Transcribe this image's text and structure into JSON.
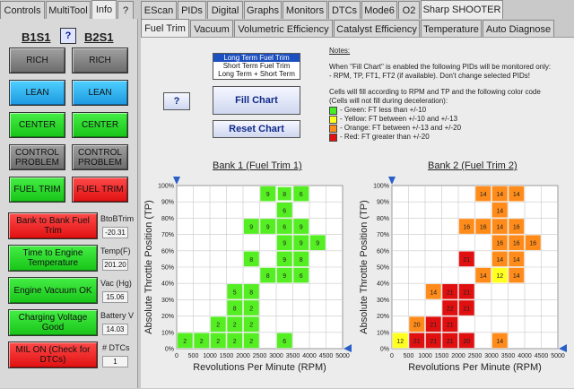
{
  "left_tabs": [
    "Controls",
    "MultiTool",
    "Info",
    "?"
  ],
  "top_tabs": [
    "EScan",
    "PIDs",
    "Digital",
    "Graphs",
    "Monitors",
    "DTCs",
    "Mode6",
    "O2",
    "Sharp SHOOTER"
  ],
  "sub_tabs": [
    "Fuel Trim",
    "Vacuum",
    "Volumetric Efficiency",
    "Catalyst Efficiency",
    "Temperature",
    "Auto Diagnose"
  ],
  "left": {
    "b1": "B1S1",
    "b2": "B2S1",
    "help": "?",
    "rows": [
      {
        "l": "RICH",
        "r": "RICH",
        "lc": "gray",
        "rc": "gray"
      },
      {
        "l": "LEAN",
        "r": "LEAN",
        "lc": "blue",
        "rc": "blue"
      },
      {
        "l": "CENTER",
        "r": "CENTER",
        "lc": "green",
        "rc": "green"
      },
      {
        "l": "CONTROL PROBLEM",
        "r": "CONTROL PROBLEM",
        "lc": "gray",
        "rc": "gray"
      },
      {
        "l": "FUEL TRIM",
        "r": "FUEL TRIM",
        "lc": "green",
        "rc": "red"
      }
    ],
    "status": [
      {
        "label": "Bank to Bank Fuel Trim",
        "color": "red",
        "vlabel": "BtoBTrim",
        "value": "-20.31"
      },
      {
        "label": "Time to Engine Temperature",
        "color": "green",
        "vlabel": "Temp(F)",
        "value": "201.20"
      },
      {
        "label": "Engine Vacuum OK",
        "color": "green",
        "vlabel": "Vac (Hg)",
        "value": "15.06"
      },
      {
        "label": "Charging Voltage Good",
        "color": "green",
        "vlabel": "Battery V",
        "value": "14.03"
      },
      {
        "label": "MIL ON (Check for DTCs)",
        "color": "red",
        "vlabel": "# DTCs",
        "value": "1"
      }
    ]
  },
  "controls": {
    "trim_options": [
      "Long Term Fuel Trim",
      "Short Term Fuel Trim",
      "Long Term + Short Term"
    ],
    "selected": 0,
    "help": "?",
    "fill": "Fill Chart",
    "reset": "Reset Chart"
  },
  "notes": {
    "title": "Notes:",
    "l1": "When \"Fill Chart\" is enabled the following PIDs will be monitored only:",
    "l2": "- RPM, TP, FT1, FT2 (if available). Don't change selected PIDs!",
    "l3": "Cells will fill according to RPM and TP and the following color code",
    "l4": "(Cells will not fill during deceleration):",
    "legend": [
      {
        "c": "#44ee22",
        "t": "- Green:   FT less than +/-10"
      },
      {
        "c": "#ffff20",
        "t": "- Yellow:  FT between +/-10 and +/-13"
      },
      {
        "c": "#ff8c1a",
        "t": "- Orange: FT between +/-13 and +/-20"
      },
      {
        "c": "#e21010",
        "t": "- Red:       FT greater than +/-20"
      }
    ]
  },
  "colors": {
    "green": "#55ee22",
    "yellow": "#ffff20",
    "orange": "#ff8c1a",
    "red": "#e01010",
    "marker": "#2a5fc8"
  },
  "chart_data": [
    {
      "type": "heatmap",
      "title": "Bank 1 (Fuel Trim 1)",
      "xlabel": "Revolutions Per Minute (RPM)",
      "ylabel": "Absolute Throttle Position (TP)",
      "xticks": [
        "0",
        "500",
        "1000",
        "1500",
        "2000",
        "2500",
        "3000",
        "3500",
        "4000",
        "4500",
        "5000"
      ],
      "yticks": [
        "0%",
        "10%",
        "20%",
        "30%",
        "40%",
        "50%",
        "60%",
        "70%",
        "80%",
        "90%",
        "100%"
      ],
      "cells": [
        {
          "c": 0,
          "r": 0,
          "v": "2",
          "col": "green"
        },
        {
          "c": 1,
          "r": 0,
          "v": "2",
          "col": "green"
        },
        {
          "c": 2,
          "r": 0,
          "v": "2",
          "col": "green"
        },
        {
          "c": 3,
          "r": 0,
          "v": "2",
          "col": "green"
        },
        {
          "c": 4,
          "r": 0,
          "v": "2",
          "col": "green"
        },
        {
          "c": 6,
          "r": 0,
          "v": "6",
          "col": "green"
        },
        {
          "c": 2,
          "r": 1,
          "v": "2",
          "col": "green"
        },
        {
          "c": 3,
          "r": 1,
          "v": "2",
          "col": "green"
        },
        {
          "c": 4,
          "r": 1,
          "v": "2",
          "col": "green"
        },
        {
          "c": 3,
          "r": 2,
          "v": "8",
          "col": "green"
        },
        {
          "c": 4,
          "r": 2,
          "v": "2",
          "col": "green"
        },
        {
          "c": 3,
          "r": 3,
          "v": "5",
          "col": "green"
        },
        {
          "c": 4,
          "r": 3,
          "v": "8",
          "col": "green"
        },
        {
          "c": 5,
          "r": 4,
          "v": "8",
          "col": "green"
        },
        {
          "c": 6,
          "r": 4,
          "v": "9",
          "col": "green"
        },
        {
          "c": 7,
          "r": 4,
          "v": "6",
          "col": "green"
        },
        {
          "c": 4,
          "r": 5,
          "v": "8",
          "col": "green"
        },
        {
          "c": 6,
          "r": 5,
          "v": "9",
          "col": "green"
        },
        {
          "c": 7,
          "r": 5,
          "v": "8",
          "col": "green"
        },
        {
          "c": 6,
          "r": 6,
          "v": "9",
          "col": "green"
        },
        {
          "c": 7,
          "r": 6,
          "v": "9",
          "col": "green"
        },
        {
          "c": 8,
          "r": 6,
          "v": "9",
          "col": "green"
        },
        {
          "c": 4,
          "r": 7,
          "v": "9",
          "col": "green"
        },
        {
          "c": 5,
          "r": 7,
          "v": "9",
          "col": "green"
        },
        {
          "c": 6,
          "r": 7,
          "v": "6",
          "col": "green"
        },
        {
          "c": 7,
          "r": 7,
          "v": "9",
          "col": "green"
        },
        {
          "c": 6,
          "r": 8,
          "v": "6",
          "col": "green"
        },
        {
          "c": 5,
          "r": 9,
          "v": "9",
          "col": "green"
        },
        {
          "c": 6,
          "r": 9,
          "v": "8",
          "col": "green"
        },
        {
          "c": 7,
          "r": 9,
          "v": "6",
          "col": "green"
        }
      ],
      "selected": {
        "c": 6,
        "r": 9
      }
    },
    {
      "type": "heatmap",
      "title": "Bank 2 (Fuel Trim 2)",
      "xlabel": "Revolutions Per Minute (RPM)",
      "ylabel": "Absolute Throttle Position (TP)",
      "xticks": [
        "0",
        "500",
        "1000",
        "1500",
        "2000",
        "2500",
        "3000",
        "3500",
        "4000",
        "4500",
        "5000"
      ],
      "yticks": [
        "0%",
        "10%",
        "20%",
        "30%",
        "40%",
        "50%",
        "60%",
        "70%",
        "80%",
        "90%",
        "100%"
      ],
      "cells": [
        {
          "c": 0,
          "r": 0,
          "v": "12",
          "col": "yellow"
        },
        {
          "c": 1,
          "r": 0,
          "v": "21",
          "col": "red"
        },
        {
          "c": 2,
          "r": 0,
          "v": "21",
          "col": "red"
        },
        {
          "c": 3,
          "r": 0,
          "v": "21",
          "col": "red"
        },
        {
          "c": 4,
          "r": 0,
          "v": "20",
          "col": "red"
        },
        {
          "c": 6,
          "r": 0,
          "v": "14",
          "col": "orange"
        },
        {
          "c": 1,
          "r": 1,
          "v": "20",
          "col": "orange"
        },
        {
          "c": 2,
          "r": 1,
          "v": "21",
          "col": "red"
        },
        {
          "c": 3,
          "r": 1,
          "v": "21",
          "col": "red"
        },
        {
          "c": 3,
          "r": 2,
          "v": "22",
          "col": "red"
        },
        {
          "c": 4,
          "r": 2,
          "v": "21",
          "col": "red"
        },
        {
          "c": 2,
          "r": 3,
          "v": "14",
          "col": "orange"
        },
        {
          "c": 3,
          "r": 3,
          "v": "21",
          "col": "red"
        },
        {
          "c": 4,
          "r": 3,
          "v": "21",
          "col": "red"
        },
        {
          "c": 5,
          "r": 4,
          "v": "14",
          "col": "orange"
        },
        {
          "c": 6,
          "r": 4,
          "v": "12",
          "col": "yellow"
        },
        {
          "c": 7,
          "r": 4,
          "v": "14",
          "col": "orange"
        },
        {
          "c": 4,
          "r": 5,
          "v": "21",
          "col": "red"
        },
        {
          "c": 6,
          "r": 5,
          "v": "14",
          "col": "orange"
        },
        {
          "c": 7,
          "r": 5,
          "v": "14",
          "col": "orange"
        },
        {
          "c": 6,
          "r": 6,
          "v": "16",
          "col": "orange"
        },
        {
          "c": 7,
          "r": 6,
          "v": "16",
          "col": "orange"
        },
        {
          "c": 8,
          "r": 6,
          "v": "16",
          "col": "orange"
        },
        {
          "c": 4,
          "r": 7,
          "v": "16",
          "col": "orange"
        },
        {
          "c": 5,
          "r": 7,
          "v": "16",
          "col": "orange"
        },
        {
          "c": 6,
          "r": 7,
          "v": "14",
          "col": "orange"
        },
        {
          "c": 7,
          "r": 7,
          "v": "16",
          "col": "orange"
        },
        {
          "c": 6,
          "r": 8,
          "v": "14",
          "col": "orange"
        },
        {
          "c": 5,
          "r": 9,
          "v": "14",
          "col": "orange"
        },
        {
          "c": 6,
          "r": 9,
          "v": "14",
          "col": "orange"
        },
        {
          "c": 7,
          "r": 9,
          "v": "14",
          "col": "orange"
        }
      ]
    }
  ]
}
